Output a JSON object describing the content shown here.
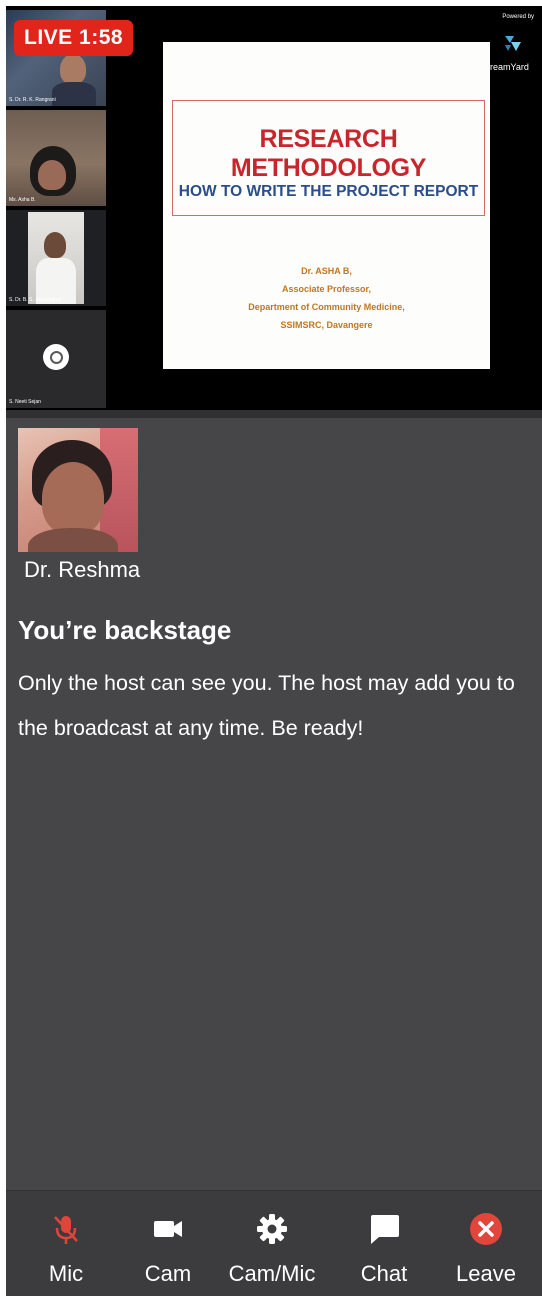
{
  "live": {
    "label": "LIVE",
    "time": "1:58"
  },
  "participants": [
    {
      "name": "S. Dr. R. K. Rangrani"
    },
    {
      "name": "Ms. Asha B."
    },
    {
      "name": "S. Dr. B. S. Jamanathal"
    },
    {
      "name": "S. Neeti Sejan"
    }
  ],
  "slide": {
    "title": "RESEARCH METHODOLOGY",
    "subtitle": "HOW TO WRITE THE PROJECT REPORT",
    "author_lines": [
      "Dr. ASHA B,",
      "Associate Professor,",
      "Department of Community Medicine,",
      "SSIMSRC, Davangere"
    ]
  },
  "branding": {
    "powered_by": "Powered by",
    "logo_text": "reamYard"
  },
  "self": {
    "name": "Dr. Reshma"
  },
  "backstage": {
    "title": "You’re backstage",
    "message": "Only the host can see you. The host may add you to the broadcast at any time. Be ready!"
  },
  "toolbar": {
    "mic_label": "Mic",
    "cam_label": "Cam",
    "cammic_label": "Cam/Mic",
    "chat_label": "Chat",
    "leave_label": "Leave"
  },
  "colors": {
    "live_red": "#e1251b",
    "mic_muted": "#e0453a",
    "leave_red": "#e2453a",
    "panel_bg": "#464649",
    "toolbar_bg": "#3c3c3f"
  }
}
